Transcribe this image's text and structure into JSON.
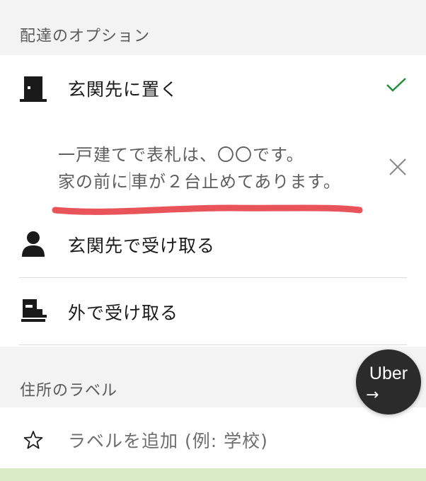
{
  "delivery_section": {
    "title": "配達のオプション",
    "options": [
      {
        "label": "玄関先に置く",
        "icon": "door-icon",
        "selected": true
      },
      {
        "label": "玄関先で受け取る",
        "icon": "person-icon",
        "selected": false
      },
      {
        "label": "外で受け取る",
        "icon": "curbside-icon",
        "selected": false
      }
    ],
    "note": {
      "line1": "一戸建てで表札は、〇〇です。",
      "line2_before_cursor": "家の前に",
      "line2_after_cursor": "車が２台止めてあります。"
    },
    "accent_color": "#1e8e3e",
    "annotation_color": "#e8545a"
  },
  "label_section": {
    "title": "住所のラベル",
    "add_label_placeholder": "ラベルを追加 (例: 学校)",
    "icon": "star-icon"
  },
  "uber_button": {
    "text": "Uber",
    "arrow": "→"
  }
}
